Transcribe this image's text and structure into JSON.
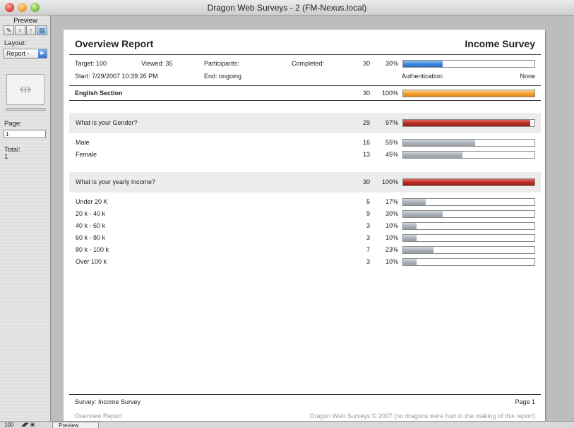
{
  "window": {
    "title": "Dragon Web Surveys - 2 (FM-Nexus.local)"
  },
  "status_area": {
    "mode": "Preview",
    "tools": [
      "pencil-icon",
      "lasso-icon",
      "lock-icon",
      "page-icon"
    ],
    "layout_label": "Layout:",
    "layout_value": "Report -",
    "page_label": "Page:",
    "page_value": "1",
    "total_label": "Total:",
    "total_value": "1"
  },
  "report": {
    "title": "Overview Report",
    "survey_name": "Income  Survey",
    "target": "Target: 100",
    "viewed": "Viewed: 35",
    "participants": "Participants:",
    "completed_label": "Completed:",
    "completed_num": "30",
    "completed_pct": "30%",
    "completed_fraction": 0.3,
    "start": "Start:  7/29/2007 10:39:26 PM",
    "end": "End:  ongoing",
    "auth_label": "Authentication:",
    "auth_value": "None",
    "section": {
      "label": "English Section",
      "num": "30",
      "pct": "100%",
      "fraction": 1.0
    },
    "questions": [
      {
        "label": "What is your Gender?",
        "num": "29",
        "pct": "97%",
        "fraction": 0.97,
        "answers": [
          {
            "label": "Male",
            "num": "16",
            "pct": "55%",
            "fraction": 0.55
          },
          {
            "label": "Female",
            "num": "13",
            "pct": "45%",
            "fraction": 0.45
          }
        ]
      },
      {
        "label": "What is your yearly income?",
        "num": "30",
        "pct": "100%",
        "fraction": 1.0,
        "answers": [
          {
            "label": "Under 20 K",
            "num": "5",
            "pct": "17%",
            "fraction": 0.17
          },
          {
            "label": "20 k - 40 k",
            "num": "9",
            "pct": "30%",
            "fraction": 0.3
          },
          {
            "label": "40 k - 60 k",
            "num": "3",
            "pct": "10%",
            "fraction": 0.1
          },
          {
            "label": "60 k - 80 k",
            "num": "3",
            "pct": "10%",
            "fraction": 0.1
          },
          {
            "label": "80 k - 100 k",
            "num": "7",
            "pct": "23%",
            "fraction": 0.23
          },
          {
            "label": "Over 100 k",
            "num": "3",
            "pct": "10%",
            "fraction": 0.1
          }
        ]
      }
    ],
    "footer_survey": "Survey: Income  Survey",
    "footer_page": "Page 1",
    "footer_report": "Overview Report",
    "footer_credit": "Dragon Web Surveys © 2007 (no dragons were hurt in the making of this report)"
  },
  "bottom_bar": {
    "zoom": "100",
    "mode": "Preview"
  },
  "colors": {
    "completed_bar": "#3b85dc",
    "section_bar": "#f29d2c",
    "question_bar": "#b52a22",
    "answer_bar": "#a7adb5"
  }
}
